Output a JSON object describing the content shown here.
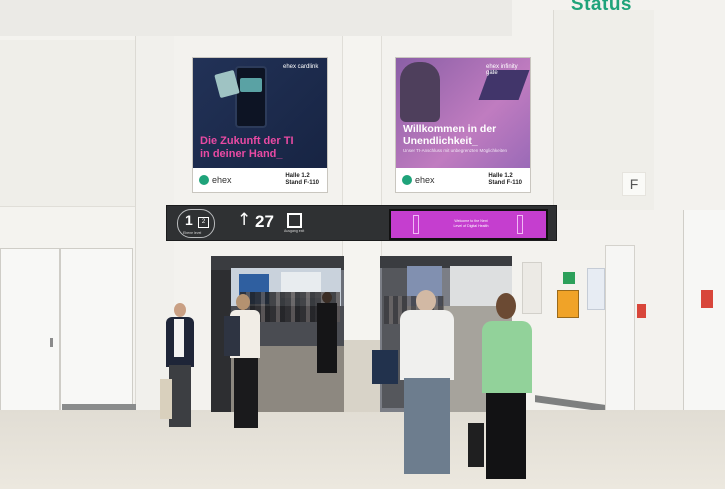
{
  "corner_text": "Status",
  "posters": [
    {
      "brand": "ehex cardlink",
      "headline_line1": "Die Zukunft der TI",
      "headline_line2": "in deiner Hand_",
      "logo_text": "ehex",
      "hall_line1": "Halle 1.2",
      "hall_line2": "Stand F-110",
      "colors": {
        "art": "#1d2b4e",
        "headline": "#e94aa3"
      }
    },
    {
      "brand": "ehex infinity gate",
      "headline_line1": "Willkommen in der",
      "headline_line2": "Unendlichkeit_",
      "subline": "Unser TI-Anschluss mit unbegrenzten Möglichkeiten",
      "logo_text": "ehex",
      "hall_line1": "Halle 1.2",
      "hall_line2": "Stand F-110",
      "colors": {
        "art": "#a86bb3",
        "headline": "#ffffff"
      }
    }
  ],
  "signage": {
    "level_number": "1",
    "level_box": "2",
    "level_caption_left": "Ebene level",
    "level_caption_right": "Ebene level",
    "arrow": "↑",
    "gate_number": "27",
    "exit_caption": "Ausgang exit",
    "screen_message_line1": "Welcome to the Next",
    "screen_message_line2": "Level of Digital Health",
    "colors": {
      "bar": "#2f3133",
      "screen": "#c53ecf"
    }
  },
  "wall_sign": "F",
  "icons": [
    "first-aid-sign-icon",
    "fire-alarm-icon",
    "door-handle-icon",
    "exit-icon"
  ]
}
